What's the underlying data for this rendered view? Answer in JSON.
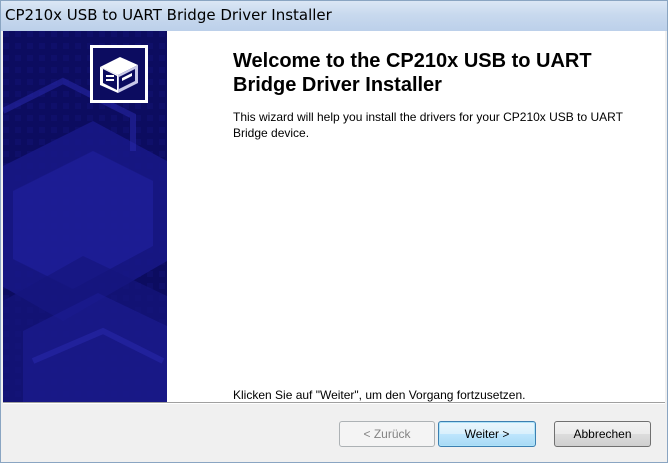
{
  "window": {
    "title": "CP210x USB to UART Bridge Driver Installer"
  },
  "sidebar": {
    "icon": "installer-box-icon"
  },
  "content": {
    "heading": "Welcome to the CP210x USB to UART Bridge Driver Installer",
    "body": "This wizard will help you install the drivers for your CP210x USB to UART Bridge device.",
    "hint": "Klicken Sie auf \"Weiter\", um den Vorgang fortzusetzen."
  },
  "buttons": {
    "back_label": "< Zurück",
    "next_label": "Weiter >",
    "cancel_label": "Abbrechen"
  },
  "colors": {
    "sidebar_bg": "#0c0c60",
    "default_button_border": "#3c7fb1"
  }
}
